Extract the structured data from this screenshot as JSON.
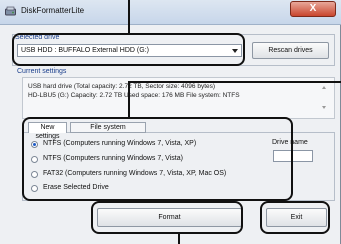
{
  "window": {
    "title": "DiskFormatterLite",
    "close_label": "X"
  },
  "selected_drive": {
    "label": "Selected drive",
    "value": "USB HDD : BUFFALO  External HDD      (G:)",
    "rescan_label": "Rescan drives"
  },
  "current_settings": {
    "label": "Current settings",
    "line1": "USB hard drive (Total capacity: 2.72 TB, Sector size: 4096 bytes)",
    "line2": "HD-LBU5 (G:)    Capacity: 2.72 TB  Used space: 176 MB  File system: NTFS"
  },
  "new_settings": {
    "tab_label": "New settings",
    "file_system_label": "File system",
    "options": [
      "NTFS (Computers running Windows 7, Vista, XP)",
      "NTFS (Computers running Windows 7, Vista)",
      "FAT32 (Computers running Windows 7, Vista, XP, Mac OS)",
      "Erase Selected Drive"
    ],
    "selected_index": 0,
    "drive_name_label": "Drive name",
    "drive_name_value": ""
  },
  "actions": {
    "format_label": "Format",
    "exit_label": "Exit"
  }
}
